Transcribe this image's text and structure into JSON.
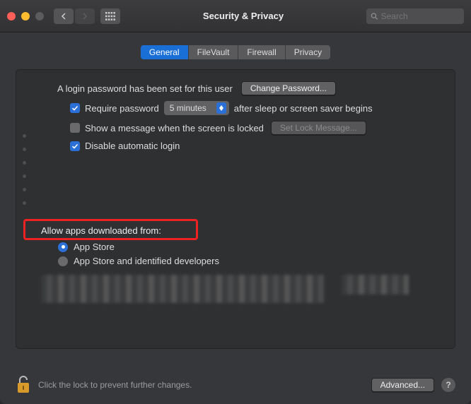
{
  "titlebar": {
    "title": "Security & Privacy",
    "search_placeholder": "Search"
  },
  "tabs": {
    "general": "General",
    "filevault": "FileVault",
    "firewall": "Firewall",
    "privacy": "Privacy"
  },
  "login": {
    "set_text": "A login password has been set for this user",
    "change_password": "Change Password...",
    "require_password": "Require password",
    "delay_value": "5 minutes",
    "after_text": "after sleep or screen saver begins",
    "show_message": "Show a message when the screen is locked",
    "set_lock_message": "Set Lock Message...",
    "disable_auto_login": "Disable automatic login"
  },
  "allow": {
    "heading": "Allow apps downloaded from:",
    "app_store": "App Store",
    "app_store_dev": "App Store and identified developers"
  },
  "footer": {
    "lock_text": "Click the lock to prevent further changes.",
    "advanced": "Advanced...",
    "help": "?"
  }
}
